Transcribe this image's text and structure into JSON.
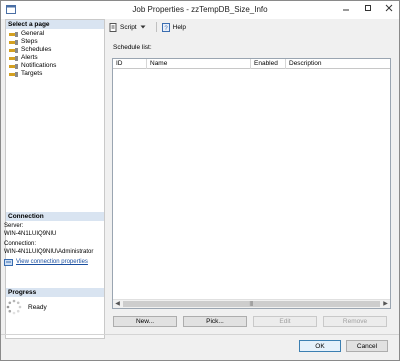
{
  "window": {
    "title": "Job Properties - zzTempDB_Size_Info"
  },
  "left_panel": {
    "select_page_header": "Select a page",
    "pages": [
      {
        "label": "General",
        "icon": "wrench-icon"
      },
      {
        "label": "Steps",
        "icon": "wrench-icon"
      },
      {
        "label": "Schedules",
        "icon": "wrench-icon"
      },
      {
        "label": "Alerts",
        "icon": "wrench-icon"
      },
      {
        "label": "Notifications",
        "icon": "wrench-icon"
      },
      {
        "label": "Targets",
        "icon": "wrench-icon"
      }
    ],
    "connection_header": "Connection",
    "server_label": "Server:",
    "server_value": "WIN-4N1LUIQ9NIU",
    "connection_label": "Connection:",
    "connection_value": "WIN-4N1LUIQ9NIU\\Administrator",
    "view_connection_link": "View connection properties",
    "progress_header": "Progress",
    "progress_status": "Ready"
  },
  "toolbar": {
    "script_label": "Script",
    "help_label": "Help"
  },
  "main": {
    "schedule_list_label": "Schedule list:",
    "columns": [
      "ID",
      "Name",
      "Enabled",
      "Description"
    ],
    "rows": []
  },
  "buttons": {
    "new": "New...",
    "pick": "Pick...",
    "edit": "Edit",
    "remove": "Remove",
    "ok": "OK",
    "cancel": "Cancel"
  },
  "colors": {
    "section_header_bg": "#d9e4f1",
    "link": "#1a4fa0"
  }
}
